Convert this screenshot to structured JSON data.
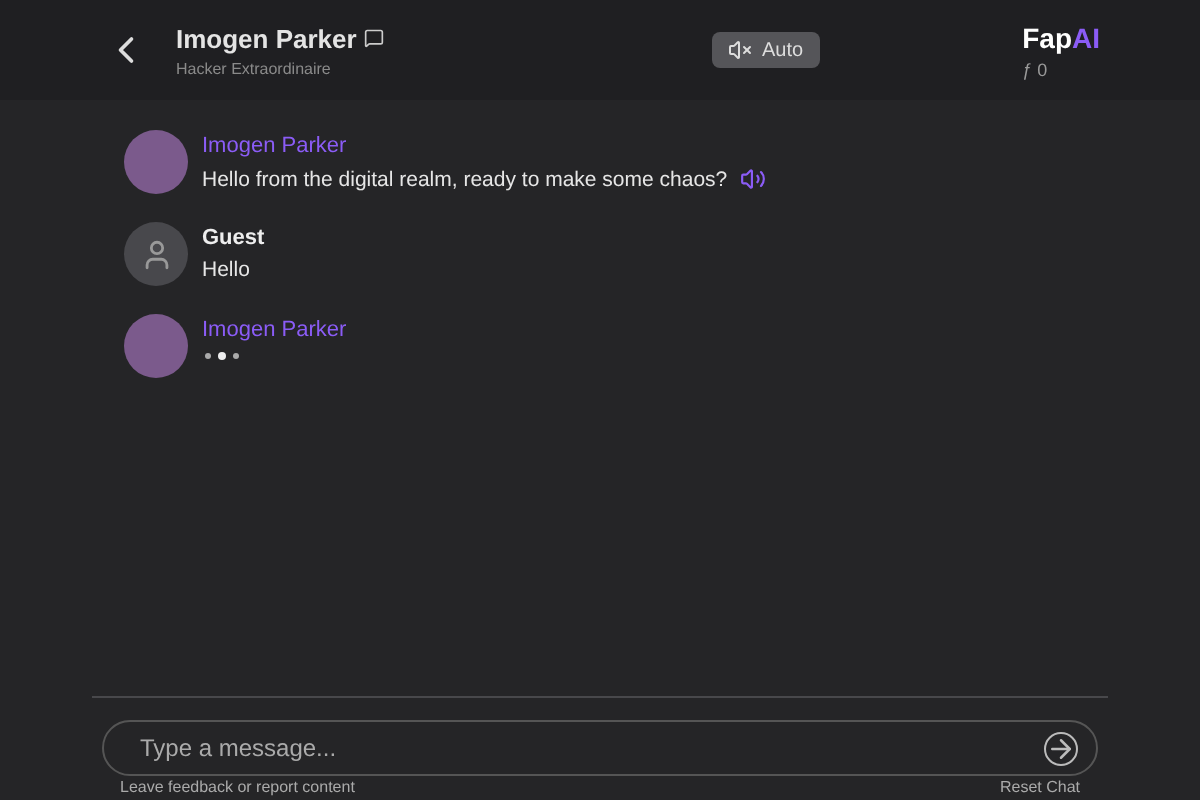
{
  "header": {
    "name": "Imogen Parker",
    "subtitle": "Hacker Extraordinaire",
    "voice": {
      "label": "Auto",
      "muted": true
    },
    "logo": {
      "main": "Fap",
      "accent": "AI"
    },
    "balance": "ƒ 0"
  },
  "messages": [
    {
      "kind": "character",
      "name": "Imogen Parker",
      "text": "Hello from the digital realm, ready to make some chaos?",
      "audio": true,
      "typing": false
    },
    {
      "kind": "user",
      "name": "Guest",
      "text": "Hello",
      "audio": false,
      "typing": false
    },
    {
      "kind": "character",
      "name": "Imogen Parker",
      "audio": false,
      "typing": true
    }
  ],
  "composer": {
    "placeholder": "Type a message..."
  },
  "footer": {
    "feedback": "Leave feedback or report content",
    "reset": "Reset Chat"
  }
}
